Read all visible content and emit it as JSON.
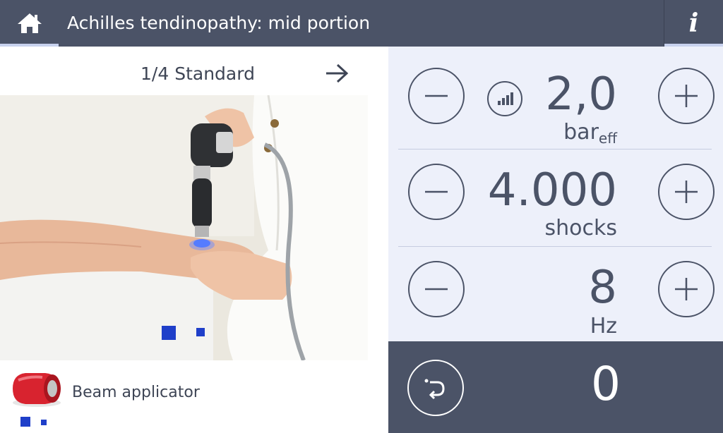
{
  "header": {
    "title": "Achilles tendinopathy: mid portion",
    "home_icon": "home-icon",
    "info_icon": "info-icon",
    "info_glyph": "i"
  },
  "protocol": {
    "step_label": "1/4 Standard",
    "next_icon": "arrow-right-icon",
    "applicator_label": "Beam applicator",
    "applicator_icon": "beam-applicator-icon"
  },
  "parameters": {
    "pressure": {
      "value": "2,0",
      "unit": "bar",
      "unit_sub": "eff",
      "level_icon": "signal-level-icon"
    },
    "shocks": {
      "value": "4.000",
      "unit": "shocks"
    },
    "frequency": {
      "value": "8",
      "unit": "Hz"
    }
  },
  "counter": {
    "value": "0",
    "reset_icon": "reset-icon"
  },
  "colors": {
    "header_bg": "#4b5367",
    "panel_bg": "#edf0fa",
    "accent_blue": "#1f3fc9",
    "applicator_red": "#d8232f"
  }
}
